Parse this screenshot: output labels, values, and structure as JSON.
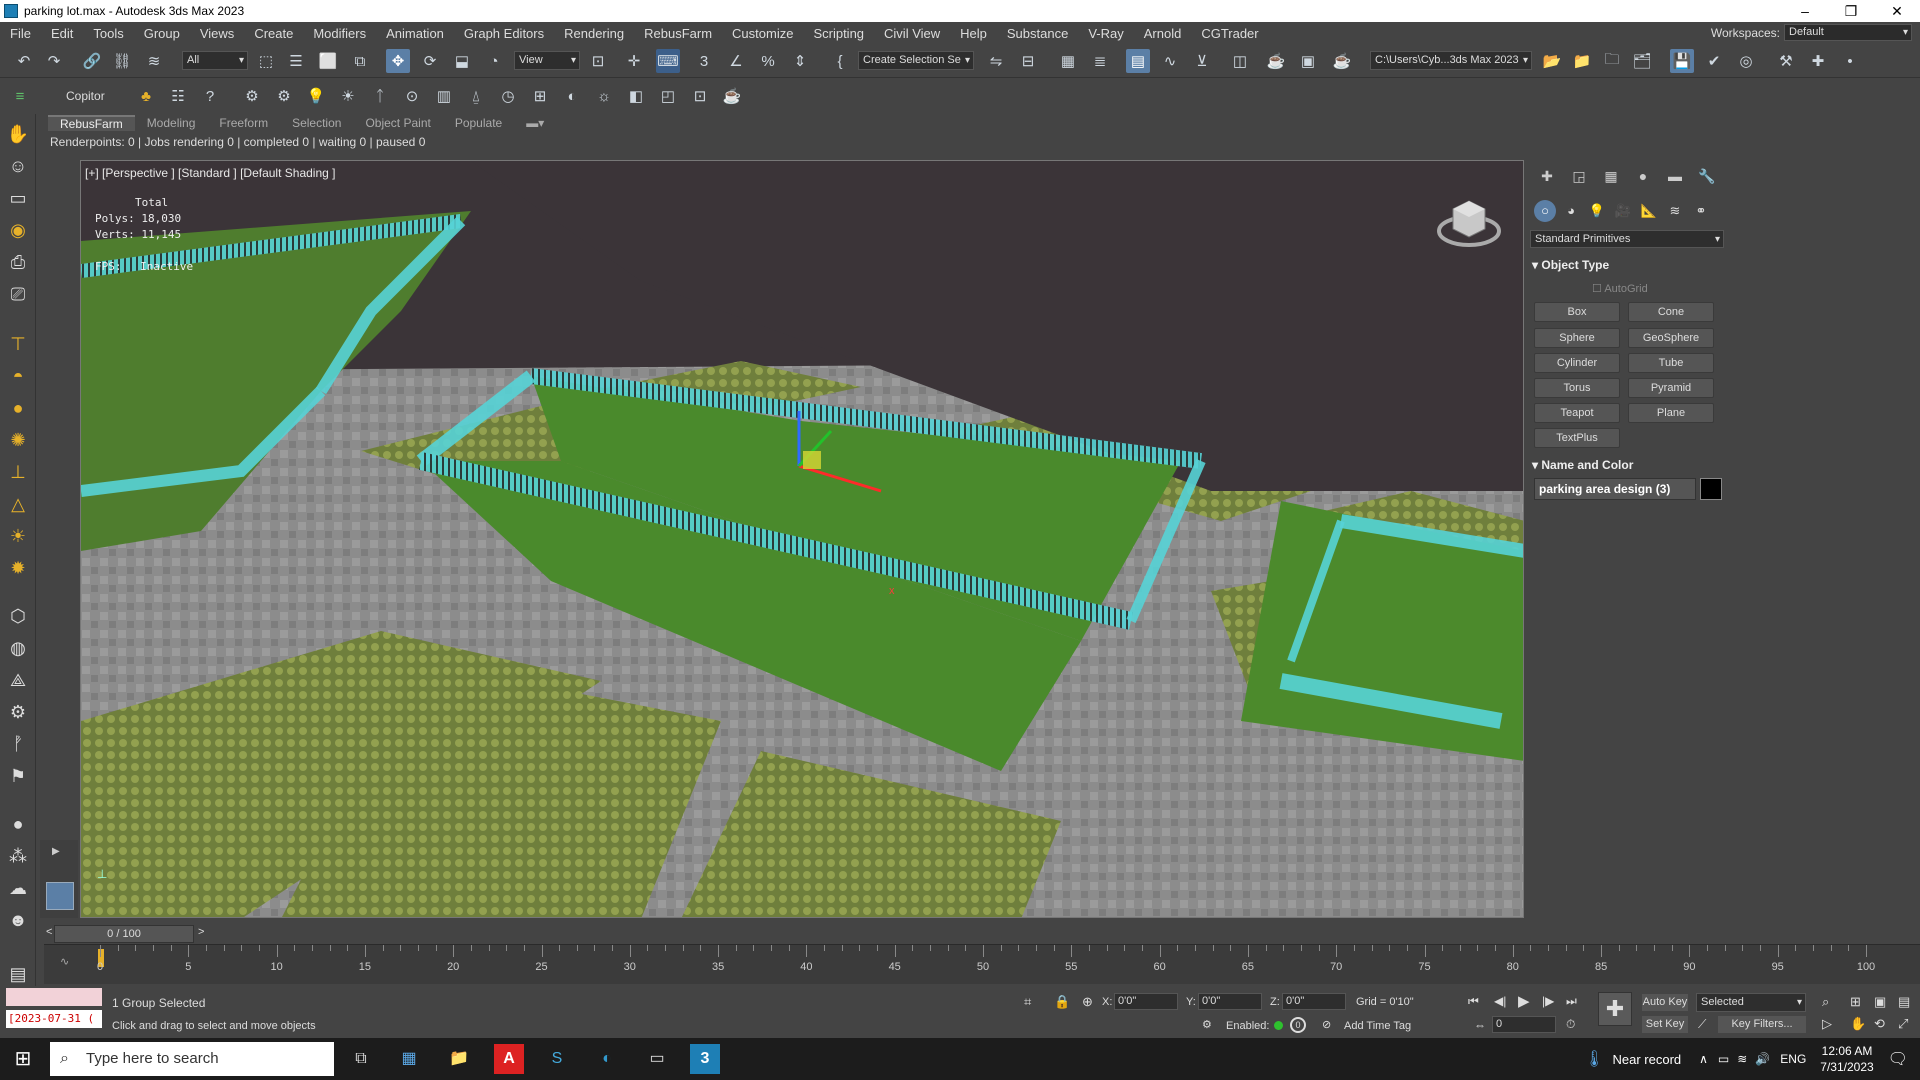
{
  "window": {
    "title": "parking lot.max - Autodesk 3ds Max 2023",
    "minimize": "–",
    "restore": "❐",
    "close": "✕"
  },
  "menu": [
    "File",
    "Edit",
    "Tools",
    "Group",
    "Views",
    "Create",
    "Modifiers",
    "Animation",
    "Graph Editors",
    "Rendering",
    "RebusFarm",
    "Customize",
    "Scripting",
    "Civil View",
    "Help",
    "Substance",
    "V-Ray",
    "Arnold",
    "CGTrader"
  ],
  "workspace": {
    "label": "Workspaces:",
    "value": "Default"
  },
  "toolbar": {
    "selection_filter": "All",
    "ref_coord": "View",
    "named_selection": "Create Selection Se",
    "project_path": "C:\\Users\\Cyb...3ds Max 2023",
    "copitor": "Copitor"
  },
  "ribbon_tabs": [
    {
      "label": "RebusFarm",
      "active": true
    },
    {
      "label": "Modeling",
      "active": false
    },
    {
      "label": "Freeform",
      "active": false
    },
    {
      "label": "Selection",
      "active": false
    },
    {
      "label": "Object Paint",
      "active": false
    },
    {
      "label": "Populate",
      "active": false
    }
  ],
  "renderpoints_status": "Renderpoints: 0 | Jobs rendering 0 | completed 0 | waiting 0 | paused 0",
  "viewport": {
    "label": "[+] [Perspective ] [Standard ] [Default Shading ]",
    "stats": {
      "header": "Total",
      "polys_label": "Polys:",
      "polys": "18,030",
      "verts_label": "Verts:",
      "verts": "11,145",
      "fps_label": "FPS:",
      "fps": "Inactive"
    },
    "gizmo_x": "x"
  },
  "command_panel": {
    "category": "Standard Primitives",
    "object_type_header": "Object Type",
    "autogrid": "AutoGrid",
    "buttons": [
      "Box",
      "Cone",
      "Sphere",
      "GeoSphere",
      "Cylinder",
      "Tube",
      "Torus",
      "Pyramid",
      "Teapot",
      "Plane",
      "TextPlus"
    ],
    "name_color_header": "Name and Color",
    "object_name": "parking area design (3)",
    "object_color": "#000000"
  },
  "timeline": {
    "frame_display": "0 / 100",
    "ticks": [
      "0",
      "5",
      "10",
      "15",
      "20",
      "25",
      "30",
      "35",
      "40",
      "45",
      "50",
      "55",
      "60",
      "65",
      "70",
      "75",
      "80",
      "85",
      "90",
      "95",
      "100"
    ]
  },
  "status": {
    "selection": "1 Group Selected",
    "prompt": "Click and drag to select and move objects",
    "date_field": "[2023-07-31 (",
    "x_label": "X:",
    "x": "0'0\"",
    "y_label": "Y:",
    "y": "0'0\"",
    "z_label": "Z:",
    "z": "0'0\"",
    "grid": "Grid = 0'10\"",
    "enabled": "Enabled:",
    "add_time_tag": "Add Time Tag",
    "auto_key": "Auto Key",
    "set_key": "Set Key",
    "key_mode": "Selected",
    "key_filters": "Key Filters...",
    "frame": "0"
  },
  "taskbar": {
    "search_placeholder": "Type here to search",
    "weather": "Near record",
    "language": "ENG",
    "time": "12:06 AM",
    "date": "7/31/2023"
  }
}
